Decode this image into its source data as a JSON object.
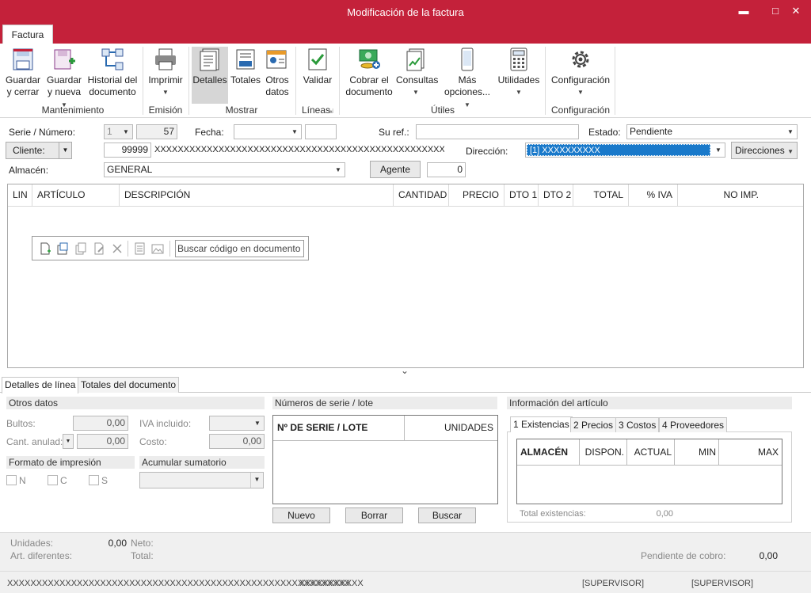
{
  "window": {
    "title": "Modificación de la factura",
    "minimize": "▬",
    "maximize": "□",
    "close": "✕"
  },
  "ribbon": {
    "tab": "Factura",
    "buttons": {
      "guardar_cerrar": [
        "Guardar",
        "y cerrar"
      ],
      "guardar_nueva": [
        "Guardar",
        "y nueva"
      ],
      "historial": [
        "Historial del",
        "documento"
      ],
      "imprimir": [
        "Imprimir",
        ""
      ],
      "detalles": "Detalles",
      "totales": "Totales",
      "otros_datos": [
        "Otros",
        "datos"
      ],
      "validar": "Validar",
      "cobrar": [
        "Cobrar el",
        "documento"
      ],
      "consultas": "Consultas",
      "mas_opciones": [
        "Más",
        "opciones..."
      ],
      "utilidades": "Utilidades",
      "configuracion": "Configuración"
    },
    "groups": {
      "mantenimiento": "Mantenimiento",
      "emision": "Emisión",
      "mostrar": "Mostrar",
      "lineas": "Líneas",
      "utiles": "Útiles",
      "configuracion": "Configuración"
    }
  },
  "header": {
    "serie_label": "Serie / Número:",
    "serie_value": "1",
    "numero_value": "57",
    "fecha_label": "Fecha:",
    "fecha_value": "",
    "su_ref_label": "Su ref.:",
    "su_ref_value": "",
    "estado_label": "Estado:",
    "estado_value": "Pendiente",
    "cliente_button": "Cliente:",
    "cliente_code": "99999",
    "cliente_name": "XXXXXXXXXXXXXXXXXXXXXXXXXXXXXXXXXXXXXXXXXXXXXXXXXXXXXXXXXXXXXXXX",
    "direccion_label": "Dirección:",
    "direccion_value": "[1]  XXXXXXXXXX",
    "direcciones_button": "Direcciones",
    "almacen_label": "Almacén:",
    "almacen_value": "GENERAL",
    "agente_button": "Agente",
    "agente_value": "0"
  },
  "grid": {
    "columns": [
      "LIN",
      "ARTÍCULO",
      "DESCRIPCIÓN",
      "CANTIDAD",
      "PRECIO",
      "DTO 1",
      "DTO 2",
      "TOTAL",
      "% IVA",
      "NO IMP."
    ],
    "search_placeholder": "Buscar código en documento",
    "expand_glyph": "⌄"
  },
  "bottom": {
    "tabs": [
      "Detalles de línea",
      "Totales del documento"
    ],
    "otros_datos": {
      "title": "Otros datos",
      "bultos_label": "Bultos:",
      "bultos_value": "0,00",
      "cant_anulada_label": "Cant. anulad:",
      "cant_anulada_value": "0,00",
      "iva_incluido_label": "IVA incluido:",
      "iva_incluido_value": "",
      "coste_label": "Costo:",
      "coste_value": "0,00"
    },
    "formato": {
      "title": "Formato de impresión",
      "options": [
        "N",
        "C",
        "S"
      ]
    },
    "acumular": {
      "title": "Acumular sumatorio",
      "value": ""
    },
    "numeros_serie": {
      "title": "Números de serie / lote",
      "columns": [
        "Nº DE SERIE / LOTE",
        "UNIDADES"
      ],
      "buttons": [
        "Nuevo",
        "Borrar",
        "Buscar"
      ]
    },
    "info_articulo": {
      "title": "Información del artículo",
      "tabs": [
        "1 Existencias",
        "2 Precios",
        "3 Costos",
        "4 Proveedores"
      ],
      "columns": [
        "ALMACÉN",
        "DISPON.",
        "ACTUAL",
        "MIN",
        "MAX"
      ],
      "total_label": "Total existencias:",
      "total_value": "0,00"
    }
  },
  "status": {
    "unidades_label": "Unidades:",
    "unidades_value": "0,00",
    "neto_label": "Neto:",
    "art_diferentes_label": "Art. diferentes:",
    "total_label": "Total:",
    "pendiente_label": "Pendiente de cobro:",
    "pendiente_value": "0,00",
    "footer_left": "XXXXXXXXXXXXXXXXXXXXXXXXXXXXXXXXXXXXXXXXXXXXXXXXXXXXXXXXXXX",
    "footer_mid": "XXXXXXXXXXX",
    "user1": "[SUPERVISOR]",
    "user2": "[SUPERVISOR]"
  },
  "colors": {
    "accent": "#c4213a",
    "selection": "#1979ca"
  }
}
